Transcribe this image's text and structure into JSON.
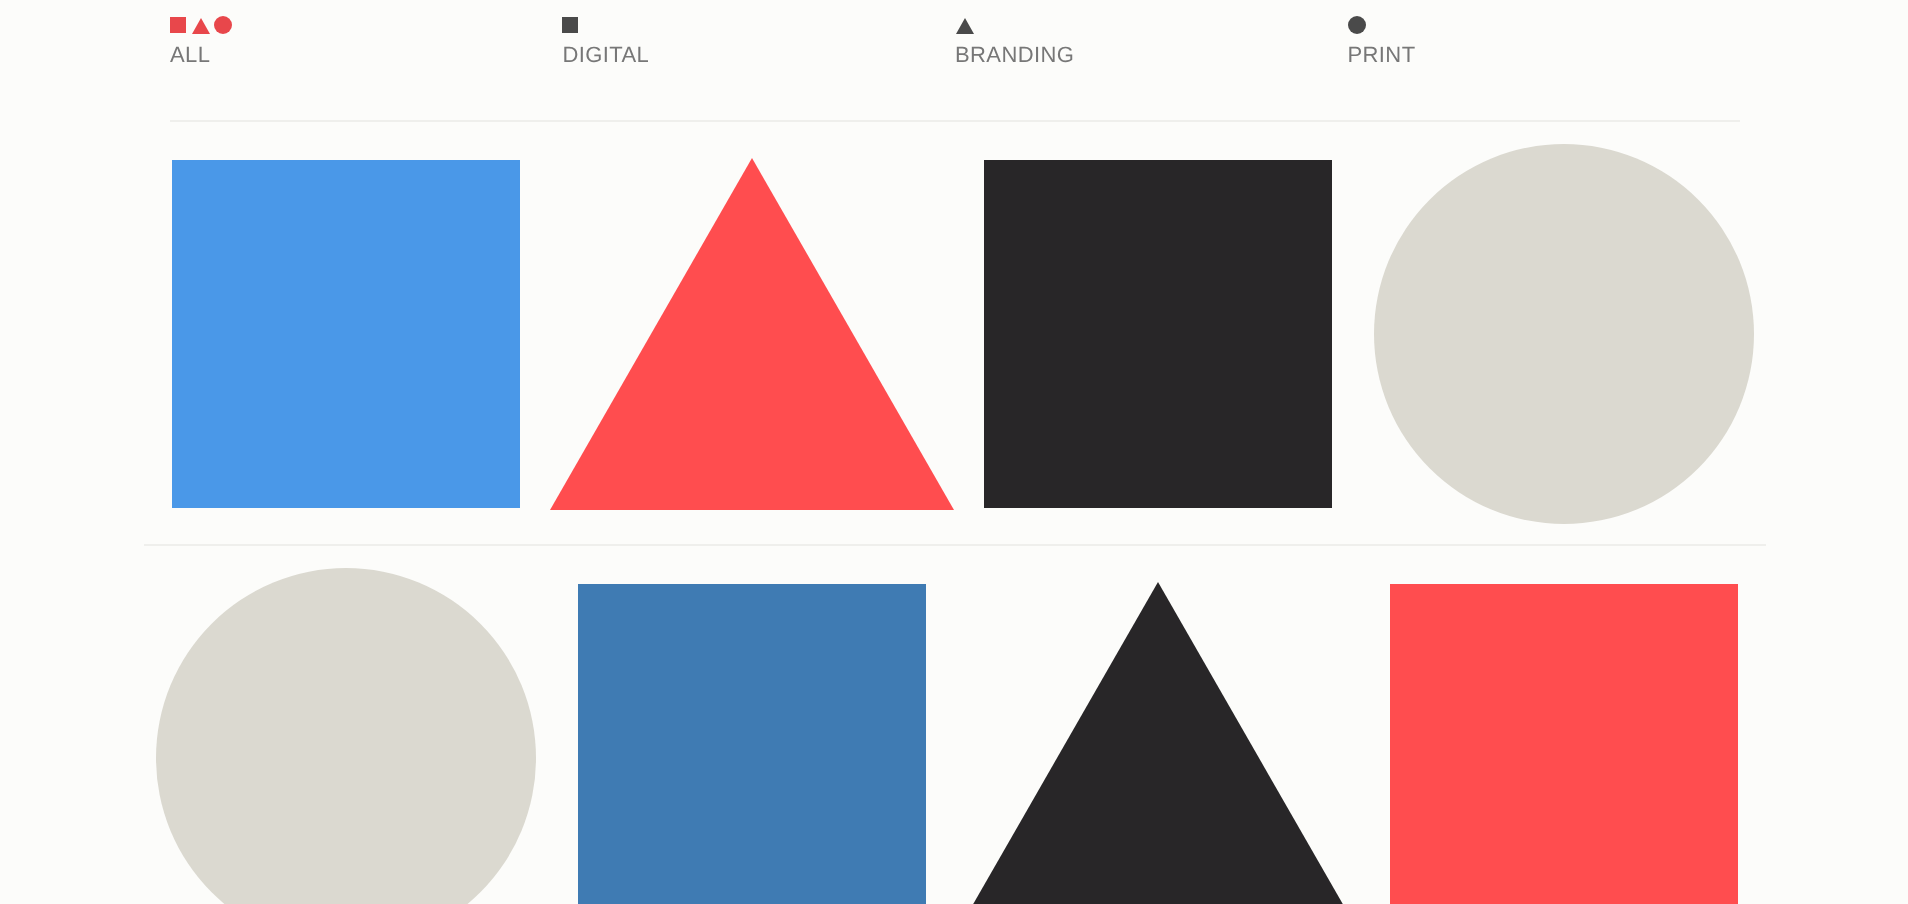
{
  "filters": [
    {
      "label": "ALL",
      "kind": "all",
      "selected": true
    },
    {
      "label": "DIGITAL",
      "kind": "square",
      "selected": false
    },
    {
      "label": "BRANDING",
      "kind": "triangle",
      "selected": false
    },
    {
      "label": "PRINT",
      "kind": "circle",
      "selected": false
    }
  ],
  "rows": [
    [
      {
        "kind": "square",
        "color": "#4a98e8"
      },
      {
        "kind": "triangle",
        "color": "#ff4d4f"
      },
      {
        "kind": "square",
        "color": "#282628"
      },
      {
        "kind": "circle",
        "color": "#dbd9d0"
      }
    ],
    [
      {
        "kind": "circle",
        "color": "#dbd9d0"
      },
      {
        "kind": "square",
        "color": "#3f7bb3"
      },
      {
        "kind": "triangle",
        "color": "#282628"
      },
      {
        "kind": "square",
        "color": "#ff4d4f"
      }
    ]
  ]
}
